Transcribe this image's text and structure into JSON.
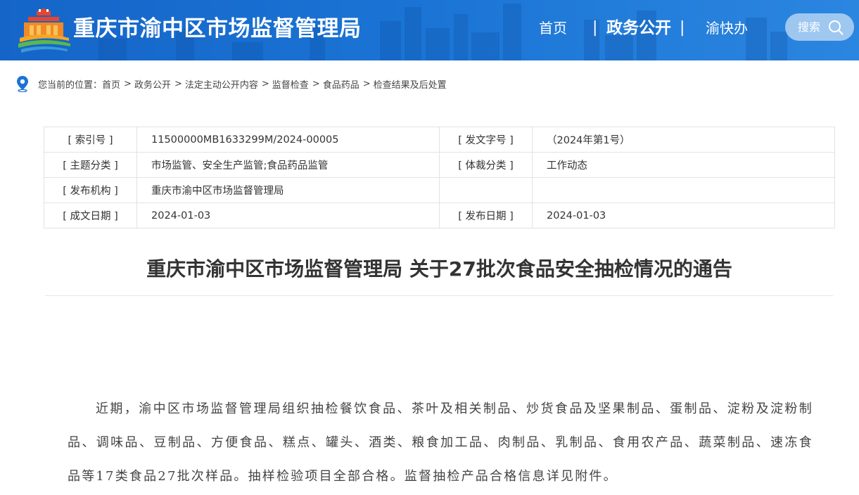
{
  "header": {
    "site_title": "重庆市渝中区市场监督管理局",
    "nav": {
      "home": "首页",
      "sep": "|",
      "open_gov": "政务公开",
      "yukuaiban": "渝快办"
    },
    "search_label": "搜索",
    "colors": {
      "header_bg": "#1a73d4",
      "logo_red": "#e8452c",
      "logo_orange": "#f5a623",
      "logo_green": "#5bb84a"
    }
  },
  "breadcrumb": {
    "prefix": "您当前的位置：",
    "items": [
      "首页",
      "政务公开",
      "法定主动公开内容",
      "监督检查",
      "食品药品",
      "检查结果及后处置"
    ],
    "sep": ">"
  },
  "info": {
    "rows": [
      {
        "label1": "[ 索引号 ]",
        "value1": "11500000MB1633299M/2024-00005",
        "label2": "[ 发文字号 ]",
        "value2": "（2024年第1号）"
      },
      {
        "label1": "[ 主题分类 ]",
        "value1": "市场监管、安全生产监管;食品药品监管",
        "label2": "[ 体裁分类 ]",
        "value2": "工作动态"
      },
      {
        "label1": "[ 发布机构 ]",
        "value1": "重庆市渝中区市场监督管理局",
        "label2": "",
        "value2": ""
      },
      {
        "label1": "[ 成文日期 ]",
        "value1": "2024-01-03",
        "label2": "[ 发布日期 ]",
        "value2": "2024-01-03"
      }
    ]
  },
  "article": {
    "title": "重庆市渝中区市场监督管理局 关于27批次食品安全抽检情况的通告",
    "body": "近期，渝中区市场监督管理局组织抽检餐饮食品、茶叶及相关制品、炒货食品及坚果制品、蛋制品、淀粉及淀粉制品、调味品、豆制品、方便食品、糕点、罐头、酒类、粮食加工品、肉制品、乳制品、食用农产品、蔬菜制品、速冻食品等17类食品27批次样品。抽样检验项目全部合格。监督抽检产品合格信息详见附件。"
  }
}
